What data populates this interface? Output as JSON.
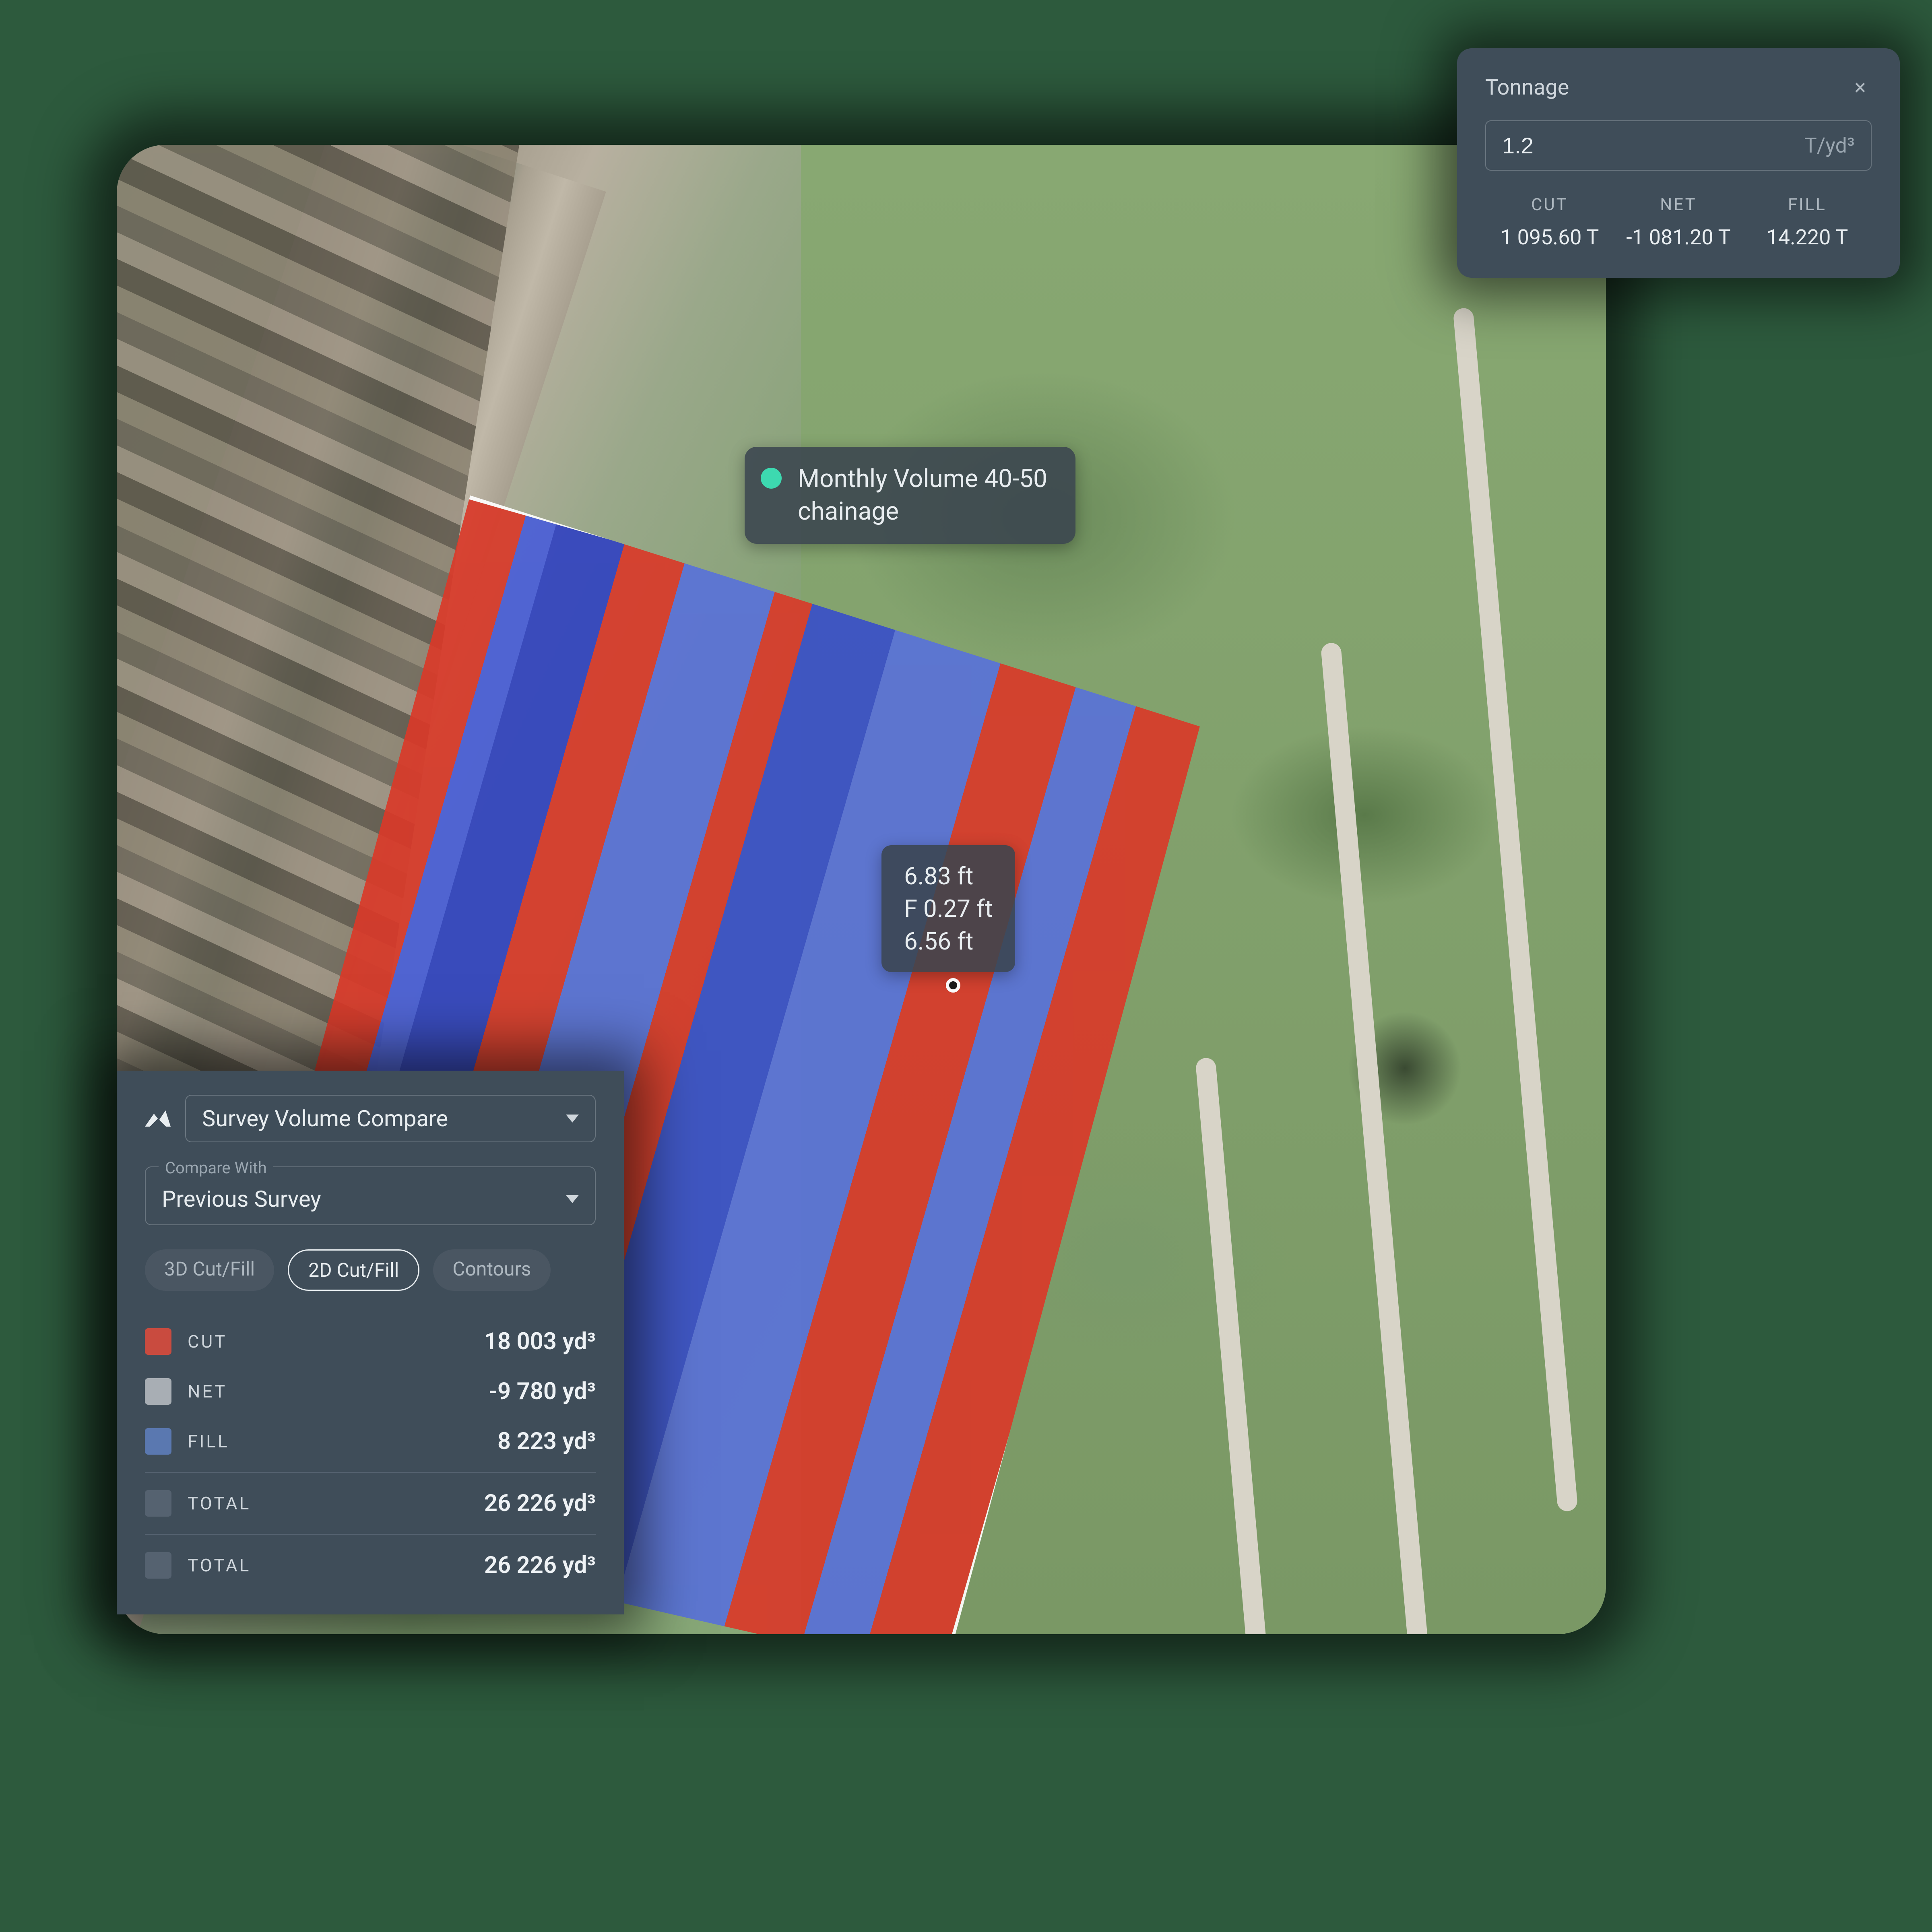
{
  "map_label": {
    "line1": "Monthly Volume 40-50",
    "line2": "chainage"
  },
  "point_readout": {
    "line1": "6.83 ft",
    "line2": "F 0.27 ft",
    "line3": "6.56 ft"
  },
  "tonnage": {
    "title": "Tonnage",
    "value": "1.2",
    "unit": "T/yd³",
    "cols": {
      "cut_label": "CUT",
      "cut_value": "1 095.60 T",
      "net_label": "NET",
      "net_value": "-1 081.20 T",
      "fill_label": "FILL",
      "fill_value": "14.220 T"
    }
  },
  "survey": {
    "mode_label": "Survey Volume Compare",
    "compare_legend": "Compare With",
    "compare_value": "Previous Survey",
    "tabs": {
      "t1": "3D Cut/Fill",
      "t2": "2D Cut/Fill",
      "t3": "Contours"
    },
    "metrics": {
      "cut_label": "CUT",
      "cut_value": "18 003 yd³",
      "net_label": "NET",
      "net_value": "-9 780 yd³",
      "fill_label": "FILL",
      "fill_value": "8 223 yd³",
      "total1_label": "TOTAL",
      "total1_value": "26 226 yd³",
      "total2_label": "TOTAL",
      "total2_value": "26 226 yd³"
    },
    "colors": {
      "cut": "#c94b3f",
      "net": "#a8aeb4",
      "fill": "#5a78b0",
      "total": "#556270"
    }
  }
}
